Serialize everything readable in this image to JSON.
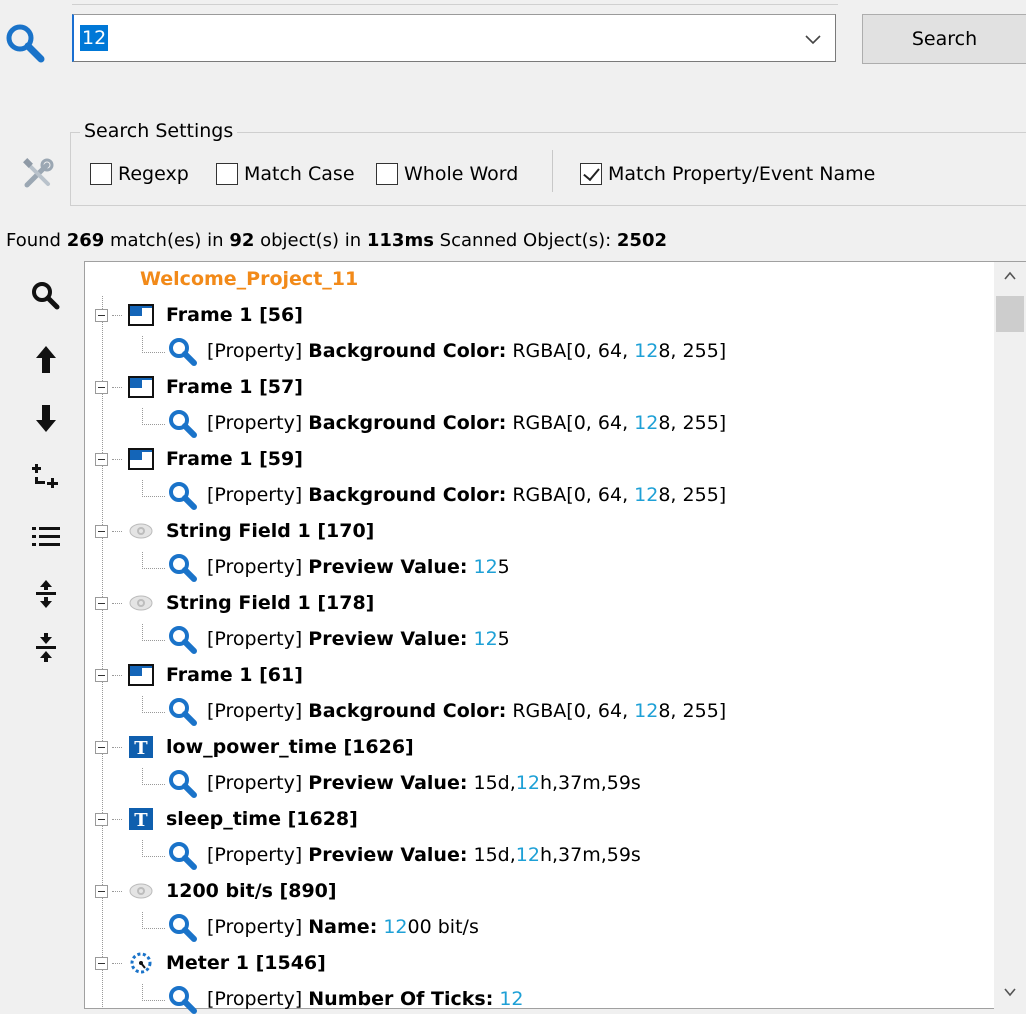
{
  "search": {
    "query": "12",
    "button_label": "Search"
  },
  "settings": {
    "legend": "Search Settings",
    "options": [
      {
        "label": "Regexp",
        "checked": false
      },
      {
        "label": "Match Case",
        "checked": false
      },
      {
        "label": "Whole Word",
        "checked": false
      },
      {
        "label": "Match Property/Event Name",
        "checked": true
      }
    ]
  },
  "status": {
    "found_label": "Found",
    "matches": "269",
    "matches_label": "match(es) in",
    "objects": "92",
    "objects_label": "object(s) in",
    "time": "113ms",
    "scanned_label": "Scanned Object(s):",
    "scanned": "2502"
  },
  "toolbar": {
    "icons": [
      "search-icon",
      "arrow-up-icon",
      "arrow-down-icon",
      "expand-all-icon",
      "list-icon",
      "expand-icon",
      "collapse-icon"
    ]
  },
  "tree": {
    "root": "Welcome_Project_11",
    "prop_tag": "[Property]",
    "items": [
      {
        "icon": "frame",
        "name": "Frame 1 [56]",
        "prop": "Background Color:",
        "pre": " RGBA[0, 64, ",
        "hit": "12",
        "post": "8, 255]"
      },
      {
        "icon": "frame",
        "name": "Frame 1 [57]",
        "prop": "Background Color:",
        "pre": " RGBA[0, 64, ",
        "hit": "12",
        "post": "8, 255]"
      },
      {
        "icon": "frame",
        "name": "Frame 1 [59]",
        "prop": "Background Color:",
        "pre": " RGBA[0, 64, ",
        "hit": "12",
        "post": "8, 255]"
      },
      {
        "icon": "eye",
        "name": "String Field 1 [170]",
        "prop": "Preview Value:",
        "pre": " ",
        "hit": "12",
        "post": "5"
      },
      {
        "icon": "eye",
        "name": "String Field 1 [178]",
        "prop": "Preview Value:",
        "pre": " ",
        "hit": "12",
        "post": "5"
      },
      {
        "icon": "frame",
        "name": "Frame 1 [61]",
        "prop": "Background Color:",
        "pre": " RGBA[0, 64, ",
        "hit": "12",
        "post": "8, 255]"
      },
      {
        "icon": "text",
        "name": "low_power_time [1626]",
        "prop": "Preview Value:",
        "pre": " 15d,",
        "hit": "12",
        "post": "h,37m,59s"
      },
      {
        "icon": "text",
        "name": "sleep_time [1628]",
        "prop": "Preview Value:",
        "pre": " 15d,",
        "hit": "12",
        "post": "h,37m,59s"
      },
      {
        "icon": "eye",
        "name": "1200 bit/s [890]",
        "prop": "Name:",
        "pre": " ",
        "hit": "12",
        "post": "00 bit/s"
      },
      {
        "icon": "meter",
        "name": "Meter 1 [1546]",
        "prop": "Number Of Ticks:",
        "pre": " ",
        "hit": "12",
        "post": ""
      }
    ]
  },
  "colors": {
    "accent": "#1a73c9",
    "highlight": "#1ea0d6",
    "root": "#f28a19",
    "selection": "#0078d7"
  }
}
